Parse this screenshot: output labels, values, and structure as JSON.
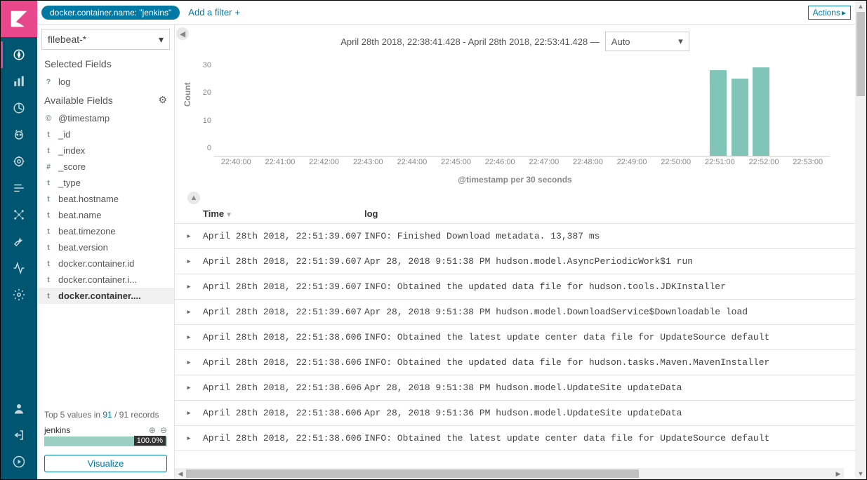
{
  "filter": {
    "pill": "docker.container.name: \"jenkins\"",
    "add": "Add a filter",
    "actions": "Actions"
  },
  "index": {
    "pattern": "filebeat-*"
  },
  "sections": {
    "selected": "Selected Fields",
    "available": "Available Fields"
  },
  "selectedFields": [
    {
      "type": "?",
      "name": "log"
    }
  ],
  "availableFields": [
    {
      "type": "©",
      "name": "@timestamp"
    },
    {
      "type": "t",
      "name": "_id"
    },
    {
      "type": "t",
      "name": "_index"
    },
    {
      "type": "#",
      "name": "_score"
    },
    {
      "type": "t",
      "name": "_type"
    },
    {
      "type": "t",
      "name": "beat.hostname"
    },
    {
      "type": "t",
      "name": "beat.name"
    },
    {
      "type": "t",
      "name": "beat.timezone"
    },
    {
      "type": "t",
      "name": "beat.version"
    },
    {
      "type": "t",
      "name": "docker.container.id"
    },
    {
      "type": "t",
      "name": "docker.container.i..."
    },
    {
      "type": "t",
      "name": "docker.container....",
      "bold": true
    }
  ],
  "topValues": {
    "prefix": "Top 5 values in ",
    "a": "91",
    "mid": " / 91 records"
  },
  "valueRow": {
    "name": "jenkins",
    "pct": "100.0%"
  },
  "visualize": "Visualize",
  "timeRange": "April 28th 2018, 22:38:41.428 - April 28th 2018, 22:53:41.428 —",
  "interval": "Auto",
  "chart_data": {
    "type": "bar",
    "title": "",
    "ylabel": "Count",
    "xlabel": "@timestamp per 30 seconds",
    "ylim": [
      0,
      35
    ],
    "yticks": [
      0,
      10,
      20,
      30
    ],
    "categories": [
      "22:40:00",
      "22:41:00",
      "22:42:00",
      "22:43:00",
      "22:44:00",
      "22:45:00",
      "22:46:00",
      "22:47:00",
      "22:48:00",
      "22:49:00",
      "22:50:00",
      "22:51:00",
      "22:52:00",
      "22:53:00"
    ],
    "bars": [
      {
        "x": 0.805,
        "value": 31
      },
      {
        "x": 0.84,
        "value": 28
      },
      {
        "x": 0.875,
        "value": 32
      }
    ]
  },
  "tableHeaders": {
    "time": "Time",
    "log": "log"
  },
  "rows": [
    {
      "time": "April 28th 2018, 22:51:39.607",
      "log": "INFO: Finished Download metadata. 13,387 ms"
    },
    {
      "time": "April 28th 2018, 22:51:39.607",
      "log": "Apr 28, 2018 9:51:38 PM hudson.model.AsyncPeriodicWork$1 run"
    },
    {
      "time": "April 28th 2018, 22:51:39.607",
      "log": "INFO: Obtained the updated data file for hudson.tools.JDKInstaller"
    },
    {
      "time": "April 28th 2018, 22:51:39.607",
      "log": "Apr 28, 2018 9:51:38 PM hudson.model.DownloadService$Downloadable load"
    },
    {
      "time": "April 28th 2018, 22:51:38.606",
      "log": "INFO: Obtained the latest update center data file for UpdateSource default"
    },
    {
      "time": "April 28th 2018, 22:51:38.606",
      "log": "INFO: Obtained the updated data file for hudson.tasks.Maven.MavenInstaller"
    },
    {
      "time": "April 28th 2018, 22:51:38.606",
      "log": "Apr 28, 2018 9:51:38 PM hudson.model.UpdateSite updateData"
    },
    {
      "time": "April 28th 2018, 22:51:38.606",
      "log": "Apr 28, 2018 9:51:36 PM hudson.model.UpdateSite updateData"
    },
    {
      "time": "April 28th 2018, 22:51:38.606",
      "log": "INFO: Obtained the latest update center data file for UpdateSource default"
    }
  ]
}
